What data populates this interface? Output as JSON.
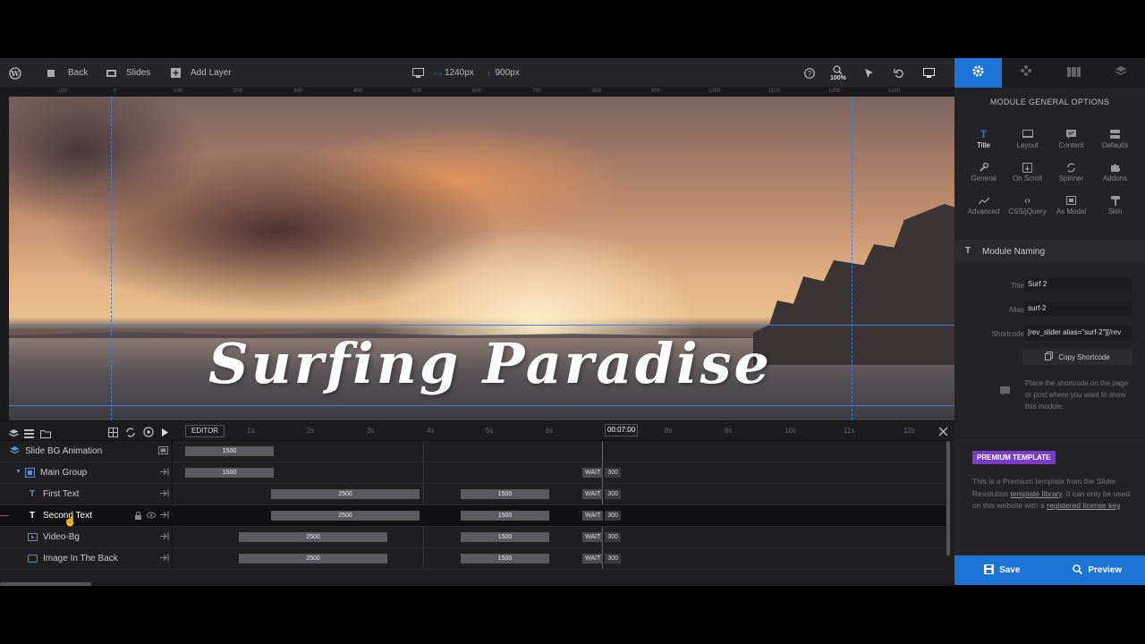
{
  "toolbar": {
    "back_label": "Back",
    "slides_label": "Slides",
    "add_layer_label": "Add Layer",
    "width_value": "1240px",
    "height_value": "900px",
    "zoom_value": "100%"
  },
  "ruler": {
    "ticks": [
      "-100",
      "0",
      "100",
      "200",
      "300",
      "400",
      "500",
      "600",
      "700",
      "800",
      "900",
      "1000",
      "1100",
      "1200",
      "1300"
    ]
  },
  "canvas": {
    "headline": "Surfing Paradise"
  },
  "timeline": {
    "editor_label": "EDITOR",
    "current_time": "00:07:00",
    "time_marks": [
      "1s",
      "2s",
      "3s",
      "4s",
      "5s",
      "6s",
      "7s",
      "8s",
      "9s",
      "10s",
      "11s",
      "12s"
    ],
    "wait_label": "WAIT",
    "layers": [
      {
        "name": "Slide BG Animation",
        "bar1": "1500"
      },
      {
        "name": "Main Group",
        "bar1": "1500",
        "wait": "300"
      },
      {
        "name": "First Text",
        "bar1": "2500",
        "bar2": "1500",
        "wait": "300"
      },
      {
        "name": "Second Text",
        "bar1": "2500",
        "bar2": "1500",
        "wait": "300"
      },
      {
        "name": "Video-Bg",
        "bar1": "2500",
        "bar2": "1500",
        "wait": "300"
      },
      {
        "name": "Image In The Back",
        "bar1": "2500",
        "bar2": "1500",
        "wait": "300"
      }
    ]
  },
  "panel": {
    "title": "MODULE GENERAL OPTIONS",
    "options": [
      {
        "label": "Title",
        "icon": "title-icon"
      },
      {
        "label": "Layout",
        "icon": "layout-icon"
      },
      {
        "label": "Content",
        "icon": "content-icon"
      },
      {
        "label": "Defaults",
        "icon": "defaults-icon"
      },
      {
        "label": "General",
        "icon": "wrench-icon"
      },
      {
        "label": "On Scroll",
        "icon": "scroll-icon"
      },
      {
        "label": "Spinner",
        "icon": "spinner-icon"
      },
      {
        "label": "Addons",
        "icon": "puzzle-icon"
      },
      {
        "label": "Advanced",
        "icon": "chart-line-icon"
      },
      {
        "label": "CSS/jQuery",
        "icon": "code-icon"
      },
      {
        "label": "As Modal",
        "icon": "modal-icon"
      },
      {
        "label": "Skin",
        "icon": "paint-icon"
      }
    ],
    "section_title": "Module Naming",
    "title_label": "Title",
    "title_value": "Surf 2",
    "alias_label": "Alias",
    "alias_value": "surf-2",
    "shortcode_label": "Shortcode",
    "shortcode_value": "[rev_slider alias=\"surf-2\"][/rev",
    "copy_label": "Copy Shortcode",
    "hint": "Place the shortcode on the page or post where you want to show this module.",
    "premium_badge": "PREMIUM TEMPLATE",
    "premium_text_1": "This is a Premium template from the Slider Revolution ",
    "premium_link_1": "template library",
    "premium_text_2": ". It can only be used on this website with a ",
    "premium_link_2": "registered license key",
    "premium_text_3": "."
  },
  "actions": {
    "save_label": "Save",
    "preview_label": "Preview"
  },
  "colors": {
    "accent": "#1b74d6",
    "premium": "#7a3cc6"
  }
}
